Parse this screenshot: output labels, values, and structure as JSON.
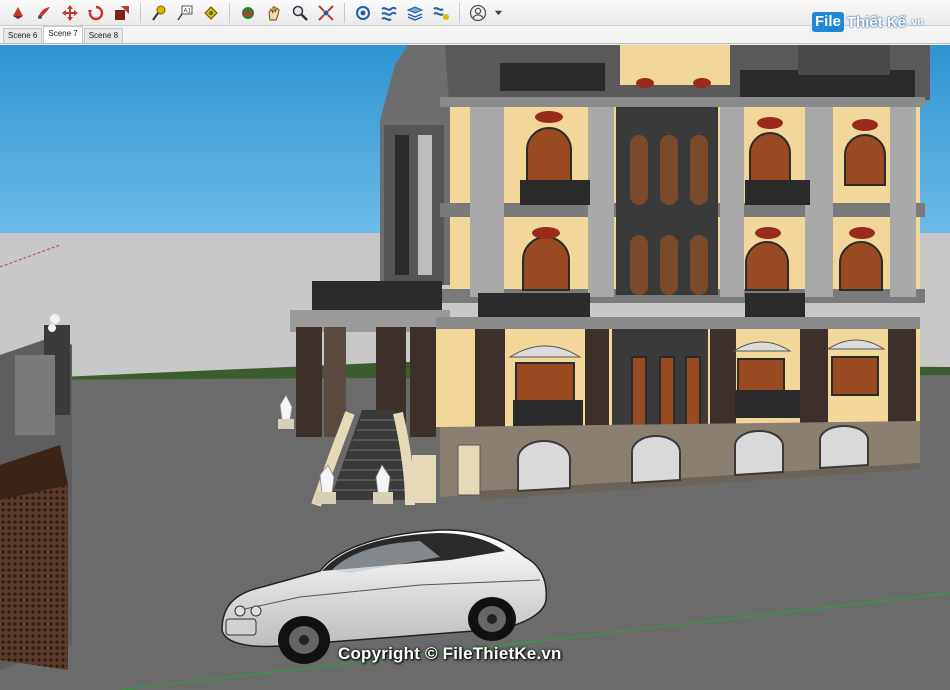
{
  "toolbar": {
    "icons": [
      "select-icon",
      "paint-icon",
      "move-icon",
      "rotate-icon",
      "scale-icon",
      "tape-measure-icon",
      "text-label-icon",
      "paint-bucket-icon",
      "orbit-icon",
      "pan-icon",
      "zoom-icon",
      "zoom-extents-icon",
      "component-icon",
      "styles-icon",
      "layers-icon",
      "shadows-icon",
      "account-icon",
      "dropdown-icon"
    ]
  },
  "scenes": [
    "Scene 6",
    "Scene 7",
    "Scene 8"
  ],
  "active_scene": "Scene 7",
  "brand": {
    "badge": "File",
    "name": "Thiết Kế",
    "tld": ".vn"
  },
  "watermark": "Copyright © FileThietKe.vn",
  "colors": {
    "sky": "#3ea2dc",
    "ground": "#6b6b6b",
    "horizon": "#c9c9c9",
    "facade": "#f1d79a",
    "trim": "#3a3a3a"
  }
}
